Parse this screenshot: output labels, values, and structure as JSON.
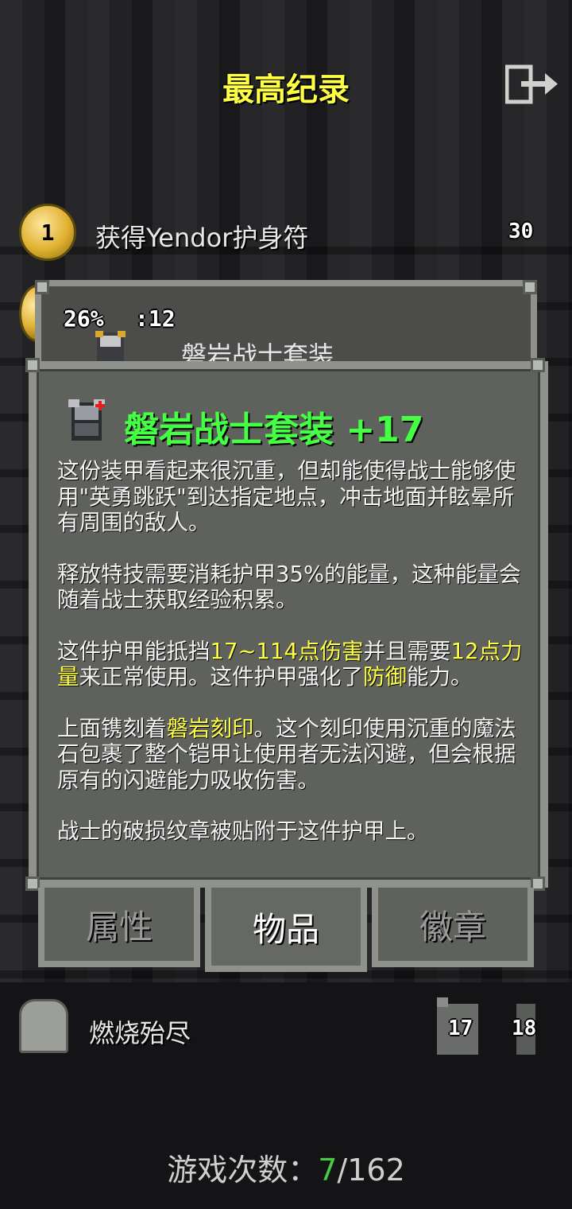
{
  "header": {
    "title": "最高纪录"
  },
  "records": [
    {
      "rank": "1",
      "description": "获得Yendor护身符",
      "score": "30"
    },
    {
      "description": "燃烧殆尽",
      "depth": "17",
      "level": "18"
    }
  ],
  "back_window": {
    "stat_left": "26%",
    "stat_right": ":12",
    "item_name": "磐岩战士套装"
  },
  "item_window": {
    "title": "磐岩战士套装 +17",
    "icon": "warrior-armor-icon",
    "para1": "这份装甲看起来很沉重，但却能使得战士能够使用\"英勇跳跃\"到达指定地点，冲击地面并眩晕所有周围的敌人。",
    "para2": "释放特技需要消耗护甲35%的能量，这种能量会随着战士获取经验积累。",
    "para3_a": "这件护甲能抵挡",
    "para3_hl1": "17~114点伤害",
    "para3_b": "并且需要",
    "para3_hl2": "12点力量",
    "para3_c": "来正常使用。这件护甲强化了",
    "para3_hl3": "防御",
    "para3_d": "能力。",
    "para4_a": "上面镌刻着",
    "para4_hl": "磐岩刻印",
    "para4_b": "。这个刻印使用沉重的魔法石包裹了整个铠甲让使用者无法闪避，但会根据原有的闪避能力吸收伤害。",
    "para5": "战士的破损纹章被贴附于这件护甲上。"
  },
  "tabs": [
    {
      "label": "属性",
      "active": false
    },
    {
      "label": "物品",
      "active": true
    },
    {
      "label": "徽章",
      "active": false
    }
  ],
  "footer": {
    "prefix": "游戏次数：",
    "wins": "7",
    "total": "/162"
  },
  "colors": {
    "title_yellow": "#ffff44",
    "item_green": "#44ff44",
    "highlight_yellow": "#ffff44",
    "window_bg": "#5f615d",
    "window_border": "#8e918c"
  }
}
